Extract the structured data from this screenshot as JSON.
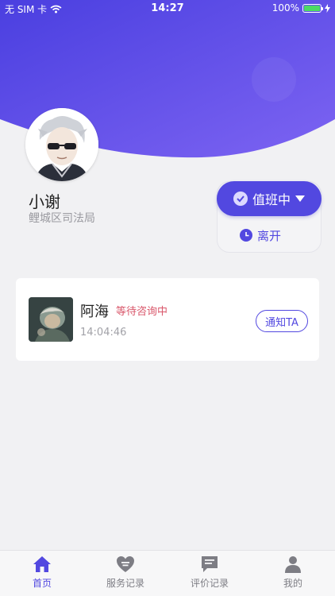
{
  "status_bar": {
    "carrier": "无 SIM 卡",
    "time": "14:27",
    "battery": "100%",
    "battery_level": 1.0
  },
  "profile": {
    "name": "小谢",
    "organization": "鲤城区司法局"
  },
  "duty": {
    "status_label": "值班中",
    "leave_label": "离开"
  },
  "session": {
    "name": "阿海",
    "status": "等待咨询中",
    "time": "14:04:46",
    "notify_label": "通知TA"
  },
  "tabs": [
    {
      "label": "首页",
      "icon": "home-icon",
      "active": true
    },
    {
      "label": "服务记录",
      "icon": "heart-list-icon",
      "active": false
    },
    {
      "label": "评价记录",
      "icon": "message-icon",
      "active": false
    },
    {
      "label": "我的",
      "icon": "person-icon",
      "active": false
    }
  ],
  "colors": {
    "accent": "#5248e0",
    "header_gradient_start": "#4a3fe0",
    "header_gradient_end": "#7a5ff0",
    "status_waiting": "#d9566a",
    "battery_green": "#4cd964"
  }
}
